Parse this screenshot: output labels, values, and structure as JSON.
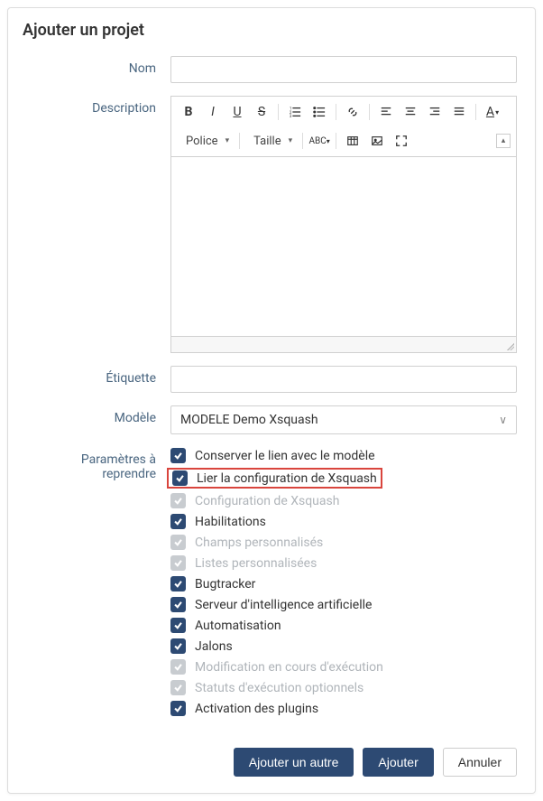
{
  "dialog": {
    "title": "Ajouter un projet"
  },
  "fields": {
    "name_label": "Nom",
    "name_value": "",
    "description_label": "Description",
    "etiquette_label": "Étiquette",
    "etiquette_value": "",
    "modele_label": "Modèle",
    "modele_value": "MODELE Demo Xsquash",
    "parametres_label": "Paramètres à reprendre"
  },
  "editor": {
    "font_dd": "Police",
    "size_dd": "Taille"
  },
  "parametres": [
    {
      "label": "Conserver le lien avec le modèle",
      "checked": true,
      "enabled": true,
      "highlight": false
    },
    {
      "label": "Lier la configuration de Xsquash",
      "checked": true,
      "enabled": true,
      "highlight": true
    },
    {
      "label": "Configuration de Xsquash",
      "checked": true,
      "enabled": false,
      "highlight": false
    },
    {
      "label": "Habilitations",
      "checked": true,
      "enabled": true,
      "highlight": false
    },
    {
      "label": "Champs personnalisés",
      "checked": true,
      "enabled": false,
      "highlight": false
    },
    {
      "label": "Listes personnalisées",
      "checked": true,
      "enabled": false,
      "highlight": false
    },
    {
      "label": "Bugtracker",
      "checked": true,
      "enabled": true,
      "highlight": false
    },
    {
      "label": "Serveur d'intelligence artificielle",
      "checked": true,
      "enabled": true,
      "highlight": false
    },
    {
      "label": "Automatisation",
      "checked": true,
      "enabled": true,
      "highlight": false
    },
    {
      "label": "Jalons",
      "checked": true,
      "enabled": true,
      "highlight": false
    },
    {
      "label": "Modification en cours d'exécution",
      "checked": true,
      "enabled": false,
      "highlight": false
    },
    {
      "label": "Statuts d'exécution optionnels",
      "checked": true,
      "enabled": false,
      "highlight": false
    },
    {
      "label": "Activation des plugins",
      "checked": true,
      "enabled": true,
      "highlight": false
    }
  ],
  "buttons": {
    "add_another": "Ajouter un autre",
    "add": "Ajouter",
    "cancel": "Annuler"
  }
}
